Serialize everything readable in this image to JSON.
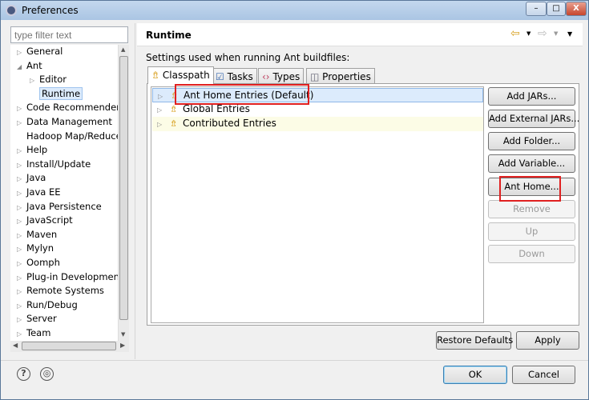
{
  "window": {
    "title": "Preferences",
    "minimize": "–",
    "maximize": "□",
    "close": "X"
  },
  "filter": {
    "placeholder": "type filter text"
  },
  "nav": {
    "items": [
      {
        "label": "General",
        "expander": "▷",
        "indent": 0
      },
      {
        "label": "Ant",
        "expander": "◢",
        "indent": 0
      },
      {
        "label": "Editor",
        "expander": "▷",
        "indent": 1
      },
      {
        "label": "Runtime",
        "expander": "",
        "indent": 1,
        "selected": true
      },
      {
        "label": "Code Recommenders",
        "expander": "▷",
        "indent": 0
      },
      {
        "label": "Data Management",
        "expander": "▷",
        "indent": 0
      },
      {
        "label": "Hadoop Map/Reduce",
        "expander": "",
        "indent": 0
      },
      {
        "label": "Help",
        "expander": "▷",
        "indent": 0
      },
      {
        "label": "Install/Update",
        "expander": "▷",
        "indent": 0
      },
      {
        "label": "Java",
        "expander": "▷",
        "indent": 0
      },
      {
        "label": "Java EE",
        "expander": "▷",
        "indent": 0
      },
      {
        "label": "Java Persistence",
        "expander": "▷",
        "indent": 0
      },
      {
        "label": "JavaScript",
        "expander": "▷",
        "indent": 0
      },
      {
        "label": "Maven",
        "expander": "▷",
        "indent": 0
      },
      {
        "label": "Mylyn",
        "expander": "▷",
        "indent": 0
      },
      {
        "label": "Oomph",
        "expander": "▷",
        "indent": 0
      },
      {
        "label": "Plug-in Development",
        "expander": "▷",
        "indent": 0
      },
      {
        "label": "Remote Systems",
        "expander": "▷",
        "indent": 0
      },
      {
        "label": "Run/Debug",
        "expander": "▷",
        "indent": 0
      },
      {
        "label": "Server",
        "expander": "▷",
        "indent": 0
      },
      {
        "label": "Team",
        "expander": "▷",
        "indent": 0
      }
    ]
  },
  "page": {
    "title": "Runtime",
    "description": "Settings used when running Ant buildfiles:",
    "nav_back": "⇦",
    "nav_fwd": "⇨",
    "dropdown": "▼"
  },
  "tabs": [
    {
      "label": "Classpath",
      "icon": "⇯"
    },
    {
      "label": "Tasks",
      "icon": "☑"
    },
    {
      "label": "Types",
      "icon": "‹›"
    },
    {
      "label": "Properties",
      "icon": "◫"
    }
  ],
  "classpath": {
    "entries": [
      "Ant Home Entries (Default)",
      "Global Entries",
      "Contributed Entries"
    ]
  },
  "buttons": {
    "add_jars": "Add JARs...",
    "add_external_jars": "Add External JARs...",
    "add_folder": "Add Folder...",
    "add_variable": "Add Variable...",
    "ant_home": "Ant Home...",
    "remove": "Remove",
    "up": "Up",
    "down": "Down",
    "restore_defaults": "Restore Defaults",
    "apply": "Apply",
    "ok": "OK",
    "cancel": "Cancel"
  },
  "footer": {
    "help": "?",
    "import": "◎"
  }
}
